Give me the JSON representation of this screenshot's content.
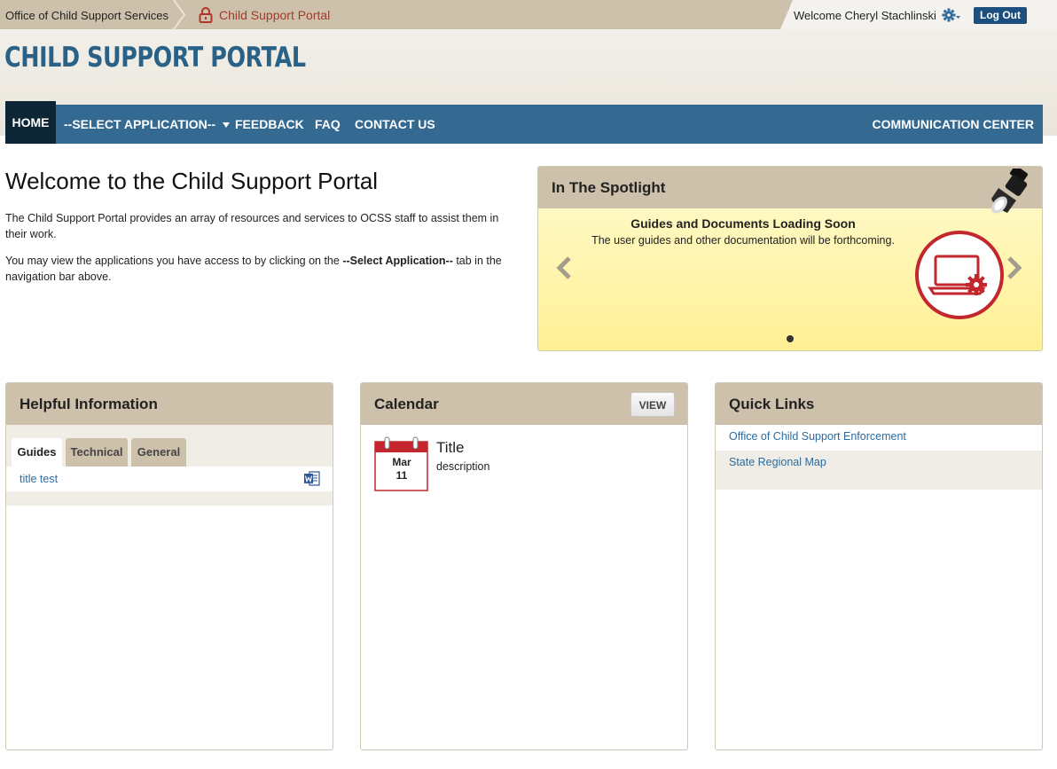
{
  "topbar": {
    "crumb_parent": "Office of Child Support Services",
    "crumb_current": "Child Support Portal",
    "welcome": "Welcome Cheryl Stachlinski",
    "logout_label": "Log Out"
  },
  "header": {
    "site_title": "CHILD SUPPORT PORTAL"
  },
  "nav": {
    "home": "HOME",
    "select_app": "--SELECT APPLICATION--",
    "feedback": "FEEDBACK",
    "faq": "FAQ",
    "contact": "CONTACT US",
    "comm_center": "COMMUNICATION CENTER"
  },
  "welcome": {
    "heading": "Welcome to the Child Support Portal",
    "para1": "The Child Support Portal provides an array of resources and services to OCSS staff to assist them in their work.",
    "para2_pre": "You may view the applications you have access to by clicking on the ",
    "para2_bold": "--Select Application--",
    "para2_post": " tab in the navigation bar above."
  },
  "spotlight": {
    "title": "In The Spotlight",
    "item_heading": "Guides and Documents Loading Soon",
    "item_text": "The user guides and other documentation will be forthcoming."
  },
  "helpful": {
    "title": "Helpful Information",
    "tabs": [
      "Guides",
      "Technical",
      "General"
    ],
    "guide_link": "title test"
  },
  "calendar": {
    "title": "Calendar",
    "view_label": "VIEW",
    "month": "Mar",
    "day": "11",
    "event_title": "Title",
    "event_desc": "description"
  },
  "quick_links": {
    "title": "Quick Links",
    "links": [
      "Office of Child Support Enforcement",
      "State Regional Map"
    ]
  },
  "colors": {
    "nav_blue": "#346a92",
    "nav_active": "#0e2536",
    "tan": "#cdc1ab",
    "accent_red": "#c3262c",
    "link_blue": "#2a6ba0"
  },
  "icons": [
    "lock-icon",
    "gear-icon",
    "chevron-down-icon",
    "lamp-icon",
    "chevron-left-icon",
    "chevron-right-icon",
    "laptop-gear-icon",
    "word-doc-icon",
    "calendar-icon"
  ]
}
